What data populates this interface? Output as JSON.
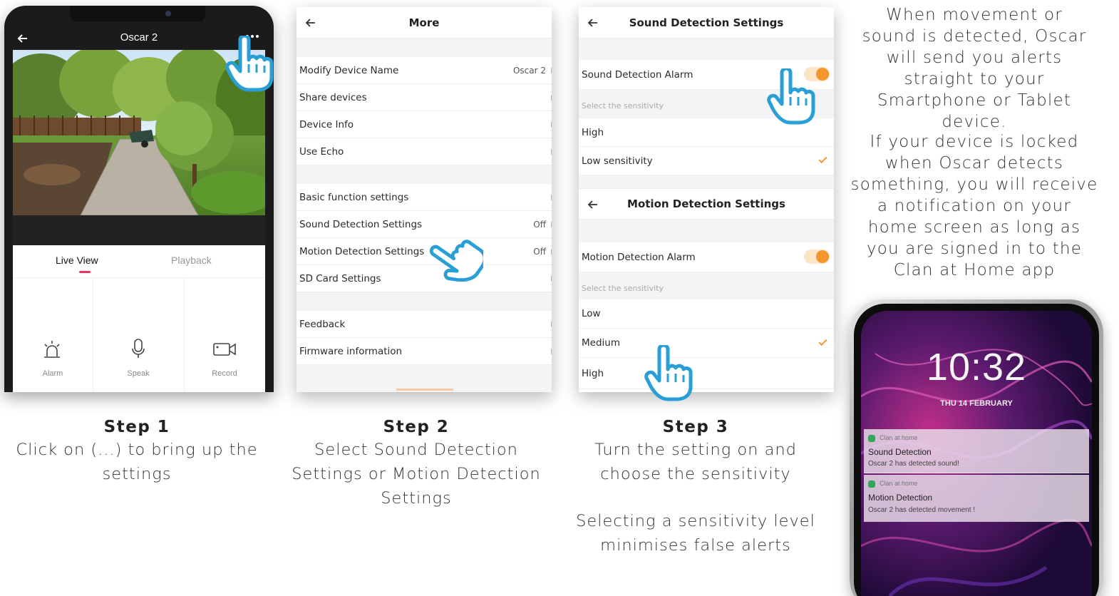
{
  "step1": {
    "title": "Oscar 2",
    "tabs": [
      {
        "label": "Live View"
      },
      {
        "label": "Playback"
      }
    ],
    "actions": [
      {
        "label": "Alarm"
      },
      {
        "label": "Speak"
      },
      {
        "label": "Record"
      }
    ],
    "caption_title": "Step 1",
    "caption_text": "Click on (...) to bring up the settings"
  },
  "step2": {
    "title": "More",
    "group1": [
      {
        "label": "Modify Device Name",
        "value": "Oscar 2"
      },
      {
        "label": "Share devices",
        "value": ""
      },
      {
        "label": "Device Info",
        "value": ""
      },
      {
        "label": "Use Echo",
        "value": ""
      }
    ],
    "group2": [
      {
        "label": "Basic function settings",
        "value": ""
      },
      {
        "label": "Sound Detection Settings",
        "value": "Off"
      },
      {
        "label": "Motion Detection Settings",
        "value": "Off"
      },
      {
        "label": "SD Card Settings",
        "value": ""
      }
    ],
    "group3": [
      {
        "label": "Feedback",
        "value": ""
      },
      {
        "label": "Firmware information",
        "value": ""
      }
    ],
    "caption_title": "Step 2",
    "caption_text": "Select Sound Detection Settings or Motion Detection Settings"
  },
  "step3": {
    "sound": {
      "title": "Sound Detection Settings",
      "alarm_label": "Sound Detection Alarm",
      "sensitivity_hint": "Select the sensitivity",
      "options": [
        "High",
        "Low sensitivity"
      ],
      "selected": "Low sensitivity"
    },
    "motion": {
      "title": "Motion Detection Settings",
      "alarm_label": "Motion Detection Alarm",
      "sensitivity_hint": "Select the sensitivity",
      "options": [
        "Low",
        "Medium",
        "High"
      ],
      "selected": "Medium"
    },
    "caption_title": "Step 3",
    "caption_text": "Turn the setting on and choose the sensitivity",
    "caption_note": "Selecting a sensitivity level minimises false alerts"
  },
  "side": {
    "paragraph1": "When movement or sound is detected, Oscar will send you alerts straight to your Smartphone or Tablet device.",
    "paragraph2": "If your device is locked when Oscar detects something, you will receive a notification on your home screen as long as you are signed in to the Clan at Home app"
  },
  "lockscreen": {
    "time": "10:32",
    "date": "THU 14 FEBRUARY",
    "notifications": [
      {
        "app": "Clan at home",
        "title": "Sound Detection",
        "body": "Oscar 2 has detected sound!"
      },
      {
        "app": "Clan at home",
        "title": "Motion Detection",
        "body": "Oscar 2 has detected movement !"
      }
    ]
  },
  "colors": {
    "accent": "#f5962b",
    "hand": "#2a9fd6",
    "tab_underline": "#e8335b"
  },
  "icons": [
    "back-arrow-icon",
    "more-dots-icon",
    "alarm-icon",
    "microphone-icon",
    "video-camera-icon",
    "pointing-hand-icon",
    "checkmark-icon"
  ]
}
